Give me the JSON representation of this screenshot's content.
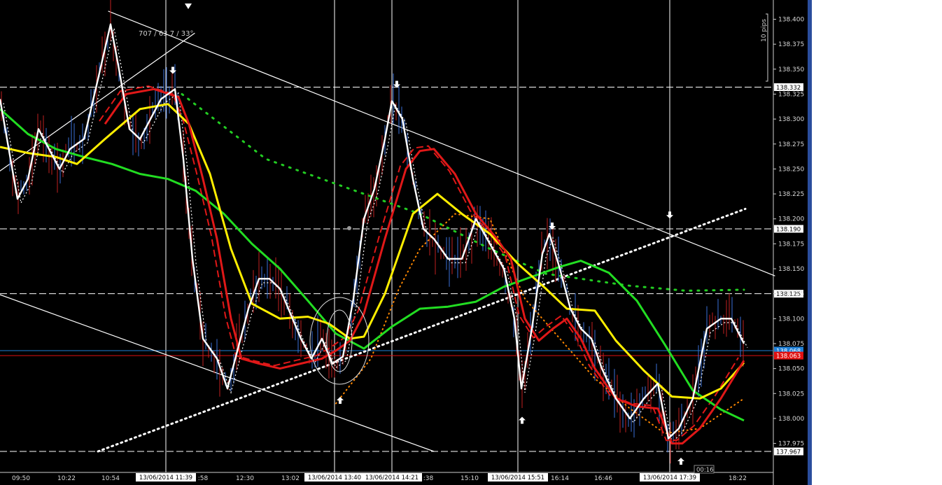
{
  "chart_data": {
    "type": "line",
    "instrument_hint": "",
    "ylim": [
      137.967,
      138.41
    ],
    "y_ticks": [
      "138.400",
      "138.375",
      "138.350",
      "138.325",
      "138.300",
      "138.275",
      "138.250",
      "138.225",
      "138.200",
      "138.175",
      "138.150",
      "138.125",
      "138.100",
      "138.075",
      "138.050",
      "138.025",
      "138.000",
      "137.975"
    ],
    "x_tick_labels": [
      "09:50",
      "10:22",
      "10:54",
      "13/06/2014 11:39",
      ":58",
      "12:30",
      "13:02",
      "13/06/2014 13:40",
      "13/06/2014 14:21",
      ":38",
      "15:10",
      "13/06/2014 15:51",
      "16:14",
      "16:46",
      "13/06/2014 17:39",
      "18:22"
    ],
    "horizontal_levels": [
      {
        "price": "138.332",
        "style": "dashed",
        "color": "#ffffff"
      },
      {
        "price": "138.190",
        "style": "dashed",
        "color": "#ffffff"
      },
      {
        "price": "138.125",
        "style": "dashed",
        "color": "#ffffff"
      },
      {
        "price": "138.068",
        "style": "solid",
        "color": "#1e7fd6"
      },
      {
        "price": "138.063",
        "style": "solid",
        "color": "#e01010"
      },
      {
        "price": "137.967",
        "style": "dashed",
        "color": "#ffffff"
      }
    ],
    "series": [
      {
        "color": "#22dd22",
        "style": "solid",
        "points": [
          [
            0,
            138.31
          ],
          [
            40,
            138.285
          ],
          [
            80,
            138.27
          ],
          [
            120,
            138.262
          ],
          [
            160,
            138.255
          ],
          [
            200,
            138.245
          ],
          [
            240,
            138.24
          ],
          [
            280,
            138.228
          ],
          [
            320,
            138.205
          ],
          [
            360,
            138.175
          ],
          [
            400,
            138.15
          ],
          [
            440,
            138.118
          ],
          [
            480,
            138.085
          ],
          [
            520,
            138.07
          ],
          [
            560,
            138.092
          ],
          [
            600,
            138.11
          ],
          [
            640,
            138.112
          ],
          [
            680,
            138.117
          ],
          [
            720,
            138.132
          ],
          [
            760,
            138.142
          ],
          [
            800,
            138.152
          ],
          [
            830,
            138.158
          ],
          [
            870,
            138.146
          ],
          [
            910,
            138.118
          ],
          [
            950,
            138.074
          ],
          [
            990,
            138.028
          ],
          [
            1030,
            138.009
          ],
          [
            1063,
            137.998
          ]
        ]
      },
      {
        "color": "#ffee00",
        "style": "solid",
        "points": [
          [
            0,
            138.272
          ],
          [
            40,
            138.266
          ],
          [
            80,
            138.262
          ],
          [
            110,
            138.255
          ],
          [
            150,
            138.28
          ],
          [
            200,
            138.31
          ],
          [
            240,
            138.315
          ],
          [
            270,
            138.295
          ],
          [
            300,
            138.245
          ],
          [
            330,
            138.17
          ],
          [
            360,
            138.115
          ],
          [
            400,
            138.1
          ],
          [
            440,
            138.102
          ],
          [
            470,
            138.095
          ],
          [
            500,
            138.08
          ],
          [
            520,
            138.082
          ],
          [
            550,
            138.125
          ],
          [
            590,
            138.205
          ],
          [
            625,
            138.225
          ],
          [
            660,
            138.205
          ],
          [
            700,
            138.185
          ],
          [
            740,
            138.155
          ],
          [
            780,
            138.13
          ],
          [
            810,
            138.11
          ],
          [
            850,
            138.108
          ],
          [
            880,
            138.078
          ],
          [
            920,
            138.048
          ],
          [
            960,
            138.022
          ],
          [
            1000,
            138.02
          ],
          [
            1030,
            138.03
          ],
          [
            1063,
            138.056
          ]
        ]
      },
      {
        "color": "#e01818",
        "style": "solid",
        "points": [
          [
            150,
            138.295
          ],
          [
            180,
            138.325
          ],
          [
            220,
            138.33
          ],
          [
            255,
            138.322
          ],
          [
            270,
            138.295
          ],
          [
            290,
            138.24
          ],
          [
            310,
            138.18
          ],
          [
            330,
            138.1
          ],
          [
            345,
            138.06
          ],
          [
            370,
            138.055
          ],
          [
            400,
            138.05
          ],
          [
            430,
            138.055
          ],
          [
            460,
            138.06
          ],
          [
            480,
            138.068
          ],
          [
            500,
            138.078
          ],
          [
            520,
            138.105
          ],
          [
            550,
            138.18
          ],
          [
            580,
            138.25
          ],
          [
            600,
            138.268
          ],
          [
            620,
            138.27
          ],
          [
            650,
            138.245
          ],
          [
            680,
            138.205
          ],
          [
            710,
            138.18
          ],
          [
            730,
            138.16
          ],
          [
            750,
            138.1
          ],
          [
            770,
            138.078
          ],
          [
            790,
            138.09
          ],
          [
            810,
            138.1
          ],
          [
            830,
            138.08
          ],
          [
            850,
            138.05
          ],
          [
            880,
            138.02
          ],
          [
            910,
            138.012
          ],
          [
            940,
            138.01
          ],
          [
            960,
            137.975
          ],
          [
            975,
            137.975
          ],
          [
            1000,
            137.99
          ],
          [
            1030,
            138.02
          ],
          [
            1063,
            138.058
          ]
        ]
      },
      {
        "color": "#ffffff",
        "style": "solid",
        "points": [
          [
            0,
            138.32
          ],
          [
            15,
            138.26
          ],
          [
            25,
            138.22
          ],
          [
            40,
            138.24
          ],
          [
            55,
            138.29
          ],
          [
            70,
            138.27
          ],
          [
            85,
            138.25
          ],
          [
            100,
            138.27
          ],
          [
            120,
            138.28
          ],
          [
            140,
            138.34
          ],
          [
            158,
            138.395
          ],
          [
            170,
            138.35
          ],
          [
            185,
            138.29
          ],
          [
            200,
            138.28
          ],
          [
            215,
            138.3
          ],
          [
            230,
            138.32
          ],
          [
            250,
            138.33
          ],
          [
            262,
            138.26
          ],
          [
            275,
            138.16
          ],
          [
            290,
            138.08
          ],
          [
            310,
            138.06
          ],
          [
            325,
            138.03
          ],
          [
            340,
            138.07
          ],
          [
            355,
            138.11
          ],
          [
            370,
            138.14
          ],
          [
            385,
            138.14
          ],
          [
            400,
            138.13
          ],
          [
            415,
            138.105
          ],
          [
            430,
            138.08
          ],
          [
            445,
            138.06
          ],
          [
            460,
            138.08
          ],
          [
            475,
            138.055
          ],
          [
            490,
            138.062
          ],
          [
            505,
            138.12
          ],
          [
            520,
            138.2
          ],
          [
            535,
            138.23
          ],
          [
            550,
            138.28
          ],
          [
            560,
            138.318
          ],
          [
            575,
            138.3
          ],
          [
            590,
            138.24
          ],
          [
            605,
            138.19
          ],
          [
            620,
            138.18
          ],
          [
            640,
            138.16
          ],
          [
            660,
            138.16
          ],
          [
            680,
            138.2
          ],
          [
            700,
            138.175
          ],
          [
            720,
            138.15
          ],
          [
            735,
            138.1
          ],
          [
            745,
            138.03
          ],
          [
            760,
            138.09
          ],
          [
            775,
            138.165
          ],
          [
            785,
            138.185
          ],
          [
            800,
            138.15
          ],
          [
            815,
            138.11
          ],
          [
            830,
            138.09
          ],
          [
            845,
            138.08
          ],
          [
            860,
            138.05
          ],
          [
            880,
            138.02
          ],
          [
            900,
            138.0
          ],
          [
            920,
            138.02
          ],
          [
            940,
            138.035
          ],
          [
            955,
            137.98
          ],
          [
            970,
            137.99
          ],
          [
            990,
            138.02
          ],
          [
            1010,
            138.09
          ],
          [
            1030,
            138.1
          ],
          [
            1045,
            138.1
          ],
          [
            1063,
            138.075
          ]
        ]
      }
    ],
    "trendlines": [
      {
        "color": "#ffffff",
        "style": "solid",
        "from": [
          155,
          138.408
        ],
        "to": [
          1107,
          138.143
        ]
      },
      {
        "color": "#ffffff",
        "style": "solid",
        "from": [
          0,
          138.124
        ],
        "to": [
          620,
          137.967
        ]
      },
      {
        "color": "#ffffff",
        "style": "solid",
        "from": [
          0,
          138.248
        ],
        "to": [
          278,
          138.386
        ]
      },
      {
        "color": "#ffffff",
        "style": "dotted",
        "from": [
          140,
          137.967
        ],
        "to": [
          1065,
          138.21
        ]
      }
    ],
    "dotted_curves": [
      {
        "color": "#22cc22",
        "points": [
          [
            260,
            138.325
          ],
          [
            380,
            138.26
          ],
          [
            500,
            138.23
          ],
          [
            600,
            138.205
          ],
          [
            700,
            138.17
          ],
          [
            780,
            138.145
          ],
          [
            900,
            138.133
          ],
          [
            980,
            138.128
          ],
          [
            1063,
            138.129
          ]
        ]
      },
      {
        "color": "#ff8800",
        "points": [
          [
            480,
            138.015
          ],
          [
            530,
            138.06
          ],
          [
            570,
            138.13
          ],
          [
            600,
            138.17
          ],
          [
            650,
            138.205
          ],
          [
            700,
            138.2
          ],
          [
            750,
            138.12
          ],
          [
            800,
            138.08
          ],
          [
            850,
            138.04
          ],
          [
            900,
            138.01
          ],
          [
            950,
            137.985
          ],
          [
            1000,
            137.99
          ],
          [
            1063,
            138.02
          ]
        ]
      }
    ],
    "arrows": [
      {
        "dir": "down",
        "x": 247,
        "price": 138.346
      },
      {
        "dir": "down",
        "x": 567,
        "price": 138.332
      },
      {
        "dir": "down",
        "x": 789,
        "price": 138.19
      },
      {
        "dir": "down",
        "x": 957,
        "price": 138.201
      },
      {
        "dir": "up",
        "x": 486,
        "price": 138.021
      },
      {
        "dir": "up",
        "x": 746,
        "price": 138.001
      },
      {
        "dir": "up",
        "x": 973,
        "price": 137.96
      }
    ],
    "annotations": {
      "angle_label": "707 / 63.7 / 33°",
      "pips_label": "10 pips",
      "timer": "00:16"
    },
    "grid": true
  }
}
